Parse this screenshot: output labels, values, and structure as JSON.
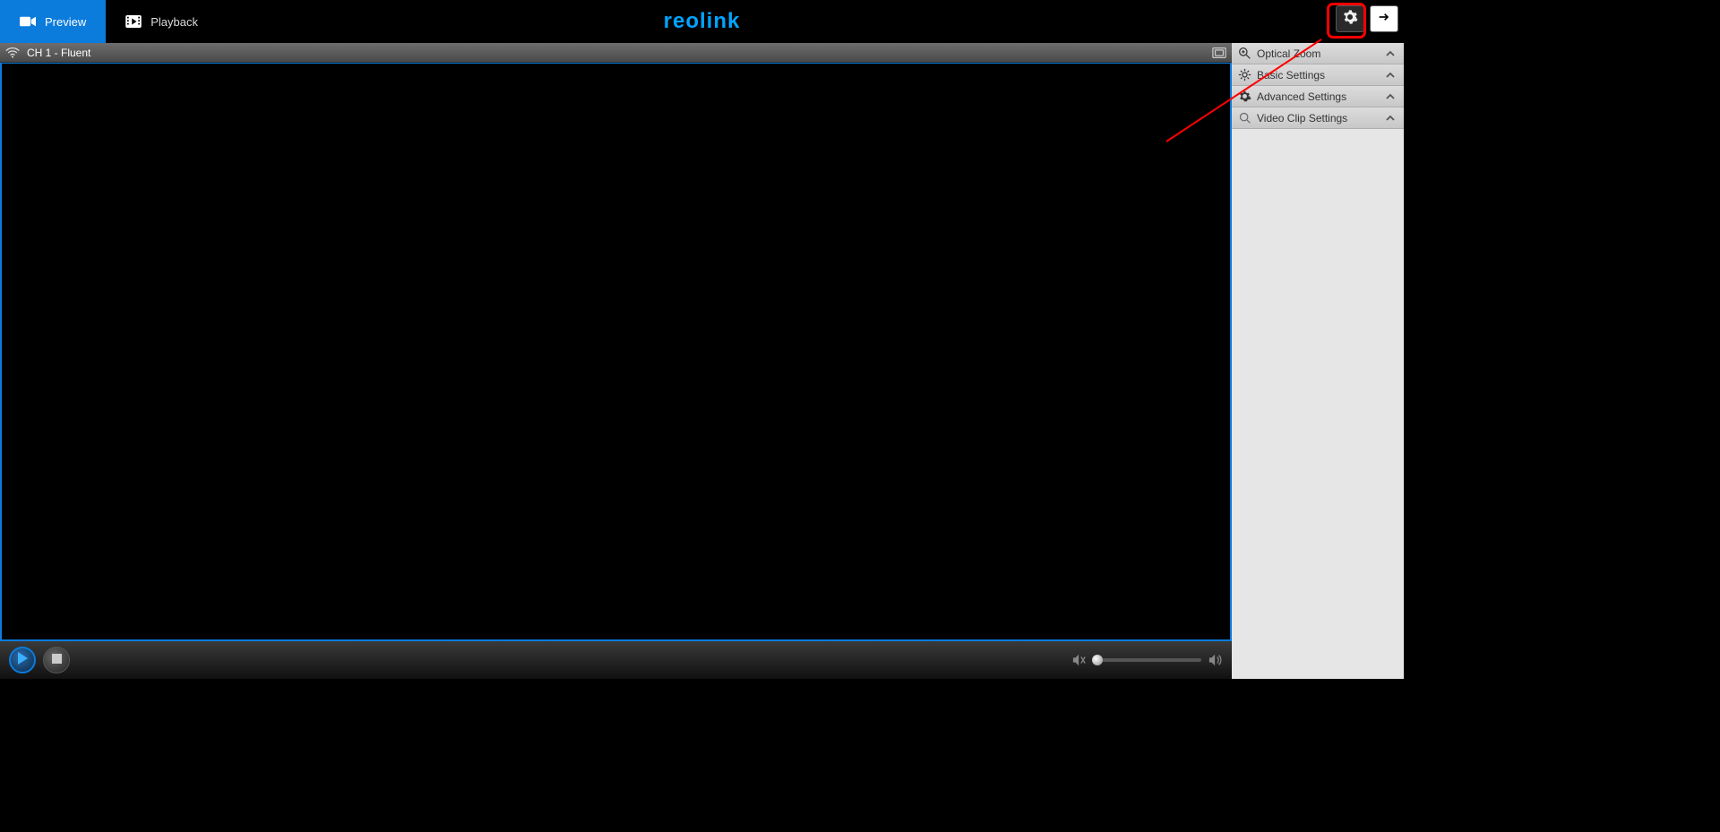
{
  "nav": {
    "preview_label": "Preview",
    "playback_label": "Playback",
    "brand": "reolink"
  },
  "video_header": {
    "channel_label": "CH 1 - Fluent"
  },
  "right_panel": {
    "items": [
      {
        "label": "Optical Zoom"
      },
      {
        "label": "Basic Settings"
      },
      {
        "label": "Advanced Settings"
      },
      {
        "label": "Video Clip Settings"
      }
    ]
  }
}
